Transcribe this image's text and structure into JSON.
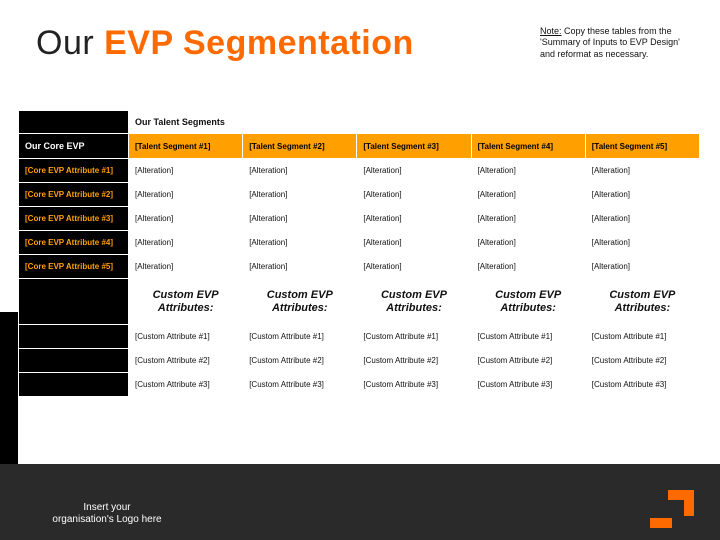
{
  "title": {
    "left": "Our ",
    "highlight": "EVP Segmentation"
  },
  "note": {
    "label": "Note:",
    "text": " Copy these tables from the 'Summary of Inputs to EVP Design' and reformat as necessary."
  },
  "table": {
    "talent_segments_header": "Our Talent Segments",
    "core_evp_label": "Our Core EVP",
    "segments": [
      "[Talent Segment #1]",
      "[Talent Segment #2]",
      "[Talent Segment #3]",
      "[Talent Segment #4]",
      "[Talent Segment #5]"
    ],
    "attributes": [
      "[Core EVP Attribute #1]",
      "[Core EVP Attribute #2]",
      "[Core EVP Attribute #3]",
      "[Core EVP Attribute #4]",
      "[Core EVP Attribute #5]"
    ],
    "alteration": "[Alteration]",
    "custom_title": "Custom EVP Attributes:",
    "custom_rows": [
      "[Custom Attribute #1]",
      "[Custom Attribute #2]",
      "[Custom Attribute #3]"
    ]
  },
  "footer": {
    "logo_placeholder": "Insert your organisation's Logo here"
  }
}
